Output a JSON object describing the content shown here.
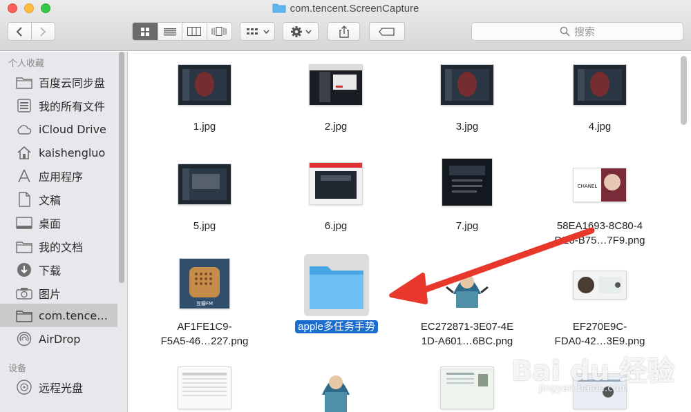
{
  "window": {
    "title": "com.tencent.ScreenCapture"
  },
  "toolbar": {
    "search_placeholder": "搜索"
  },
  "sidebar": {
    "favorites_header": "个人收藏",
    "devices_header": "设备",
    "items": [
      {
        "label": "百度云同步盘",
        "icon": "folder-icon"
      },
      {
        "label": "我的所有文件",
        "icon": "all-files-icon"
      },
      {
        "label": "iCloud Drive",
        "icon": "cloud-icon"
      },
      {
        "label": "kaishengluo",
        "icon": "home-icon"
      },
      {
        "label": "应用程序",
        "icon": "applications-icon"
      },
      {
        "label": "文稿",
        "icon": "document-icon"
      },
      {
        "label": "桌面",
        "icon": "desktop-icon"
      },
      {
        "label": "我的文档",
        "icon": "folder-icon"
      },
      {
        "label": "下载",
        "icon": "download-icon"
      },
      {
        "label": "图片",
        "icon": "camera-icon"
      },
      {
        "label": "com.tence…",
        "icon": "folder-icon"
      },
      {
        "label": "AirDrop",
        "icon": "airdrop-icon"
      }
    ],
    "devices": [
      {
        "label": "远程光盘",
        "icon": "disc-icon"
      }
    ]
  },
  "files": [
    {
      "name": "1.jpg",
      "line2": ""
    },
    {
      "name": "2.jpg",
      "line2": ""
    },
    {
      "name": "3.jpg",
      "line2": ""
    },
    {
      "name": "4.jpg",
      "line2": ""
    },
    {
      "name": "5.jpg",
      "line2": ""
    },
    {
      "name": "6.jpg",
      "line2": ""
    },
    {
      "name": "7.jpg",
      "line2": ""
    },
    {
      "name": "58EA1693-8C80-4",
      "line2": "DE0-B75…7F9.png"
    },
    {
      "name": "AF1FE1C9-",
      "line2": "F5A5-46…227.png"
    },
    {
      "name": "apple多任务手势",
      "line2": ""
    },
    {
      "name": "EC272871-3E07-4E",
      "line2": "1D-A601…6BC.png"
    },
    {
      "name": "EF270E9C-",
      "line2": "FDA0-42…3E9.png"
    }
  ],
  "thumb_text": {
    "fm": "豆瓣FM",
    "chanel": "CHANEL"
  },
  "watermark": {
    "main": "Bai du 经验",
    "sub": "jingyan.baidu.com"
  },
  "colors": {
    "selection": "#1d6ccf",
    "folder": "#5eb6ef",
    "arrow": "#e8372b"
  }
}
